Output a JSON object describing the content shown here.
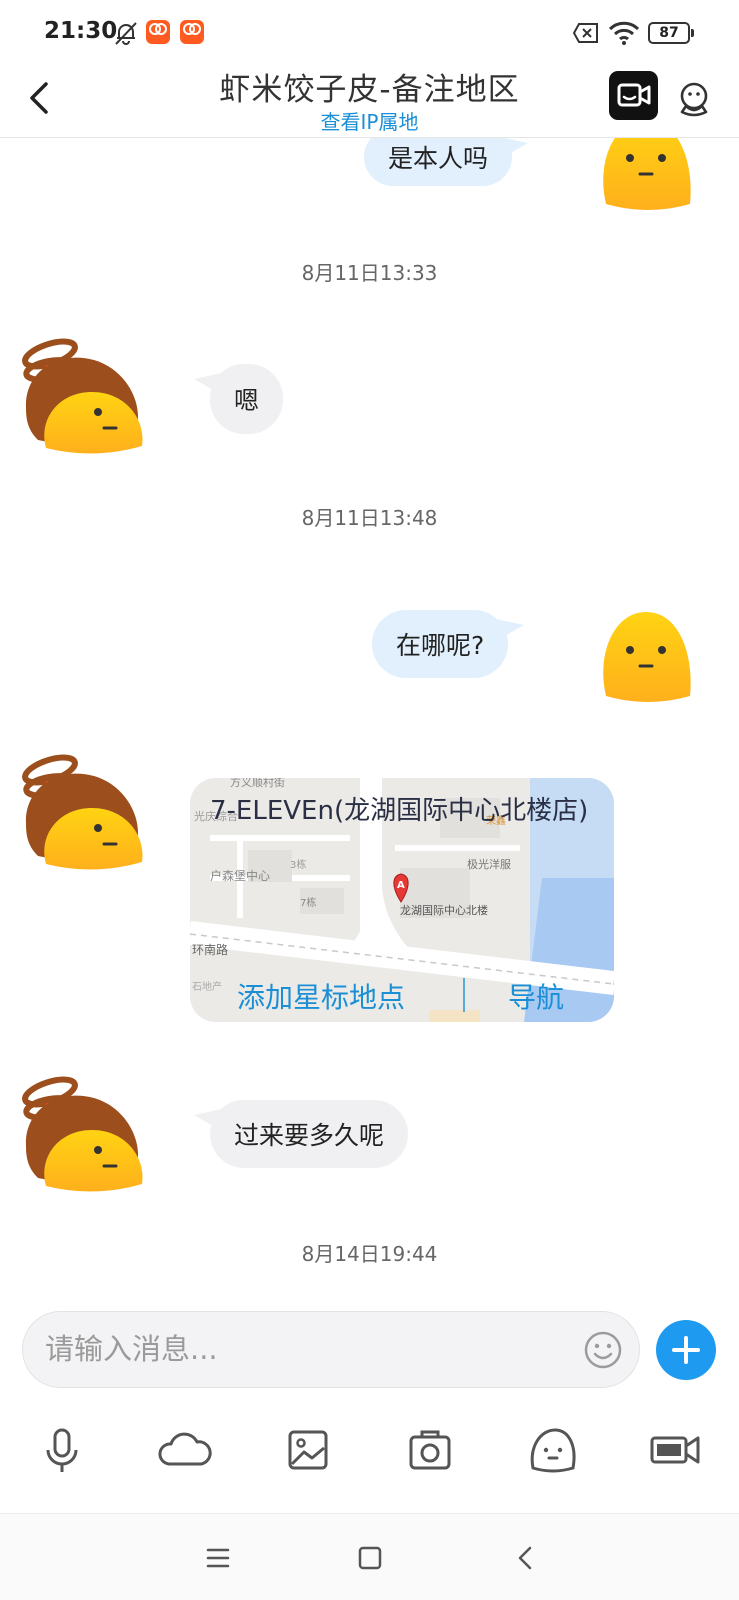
{
  "status_bar": {
    "time": "21:30",
    "battery": "87",
    "icons": [
      "bell-off-icon",
      "app-badge-icon",
      "app-badge-icon",
      "sim-off-icon",
      "wifi-icon",
      "battery-icon"
    ]
  },
  "header": {
    "title": "虾米饺子皮-备注地区",
    "subtitle_link": "查看IP属地",
    "icons": [
      "back-arrow-icon",
      "video-call-icon",
      "profile-icon"
    ]
  },
  "messages": [
    {
      "side": "right",
      "type": "text",
      "text": "是本人吗"
    },
    {
      "type": "timestamp",
      "text": "8月11日13:33"
    },
    {
      "side": "left",
      "type": "text",
      "text": "嗯"
    },
    {
      "type": "timestamp",
      "text": "8月11日13:48"
    },
    {
      "side": "right",
      "type": "text",
      "text": "在哪呢?"
    },
    {
      "side": "left",
      "type": "location",
      "title": "7-ELEVEn(龙湖国际中心北楼店)",
      "map_labels": [
        "方义顺村街",
        "光庆综合",
        "户森堡中心",
        "3栋",
        "7栋",
        "极光洋服",
        "龙湖国际中心北楼",
        "环南路",
        "石地产",
        "荣鑫"
      ],
      "marker": "A",
      "actions": {
        "star": "添加星标地点",
        "navigate": "导航"
      }
    },
    {
      "side": "left",
      "type": "text",
      "text": "过来要多久呢"
    },
    {
      "type": "timestamp",
      "text": "8月14日19:44"
    }
  ],
  "composer": {
    "placeholder": "请输入消息...",
    "value": "",
    "toolbar_icons": [
      "microphone-icon",
      "cloud-icon",
      "image-icon",
      "camera-icon",
      "sticker-icon",
      "gif-icon"
    ]
  },
  "nav_bar": {
    "icons": [
      "menu-icon",
      "home-icon",
      "back-icon"
    ]
  },
  "colors": {
    "accent": "#1e9bf0",
    "link": "#1a8fd6",
    "bubble_right": "#e1f0fc",
    "bubble_left": "#f0f0f2"
  }
}
